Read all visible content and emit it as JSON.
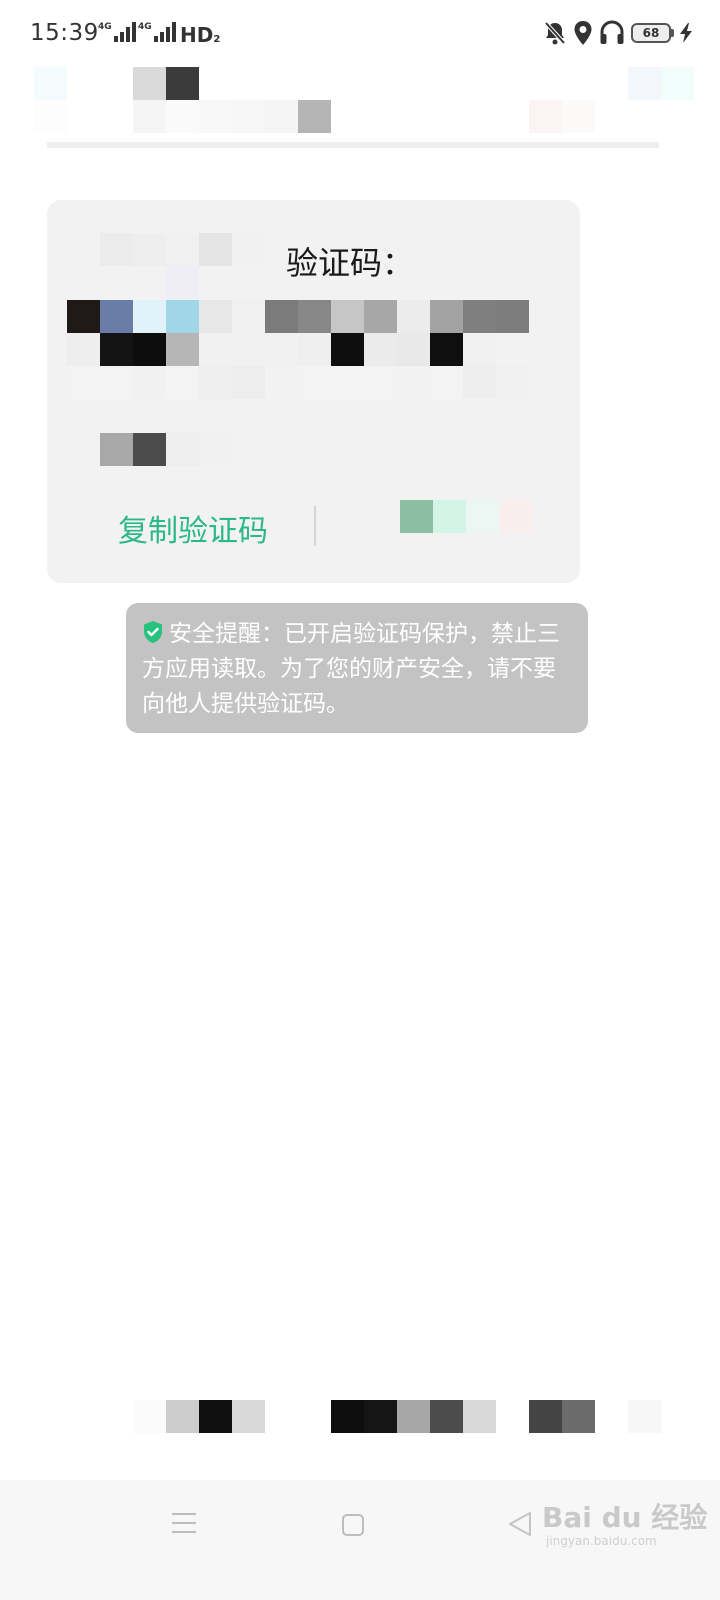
{
  "status_bar": {
    "time": "15:39",
    "signal1_tag": "4G",
    "signal2_tag": "4G",
    "network_label": "HD",
    "network_sub": "2",
    "battery_level": "68",
    "icons": [
      "mute-bell-icon",
      "location-pin-icon",
      "headset-icon",
      "battery-icon",
      "charging-bolt-icon"
    ]
  },
  "card": {
    "title": "验证码：",
    "copy_label": "复制验证码"
  },
  "toast": {
    "text": "安全提醒：已开启验证码保护，禁止三方应用读取。为了您的财产安全，请不要向他人提供验证码。"
  },
  "watermark": {
    "brand": "Bai du 经验",
    "url": "jingyan.baidu.com"
  },
  "colors": {
    "accent": "#2db888",
    "toast_bg": "#c3c3c3",
    "card_bg": "#f2f2f2"
  }
}
